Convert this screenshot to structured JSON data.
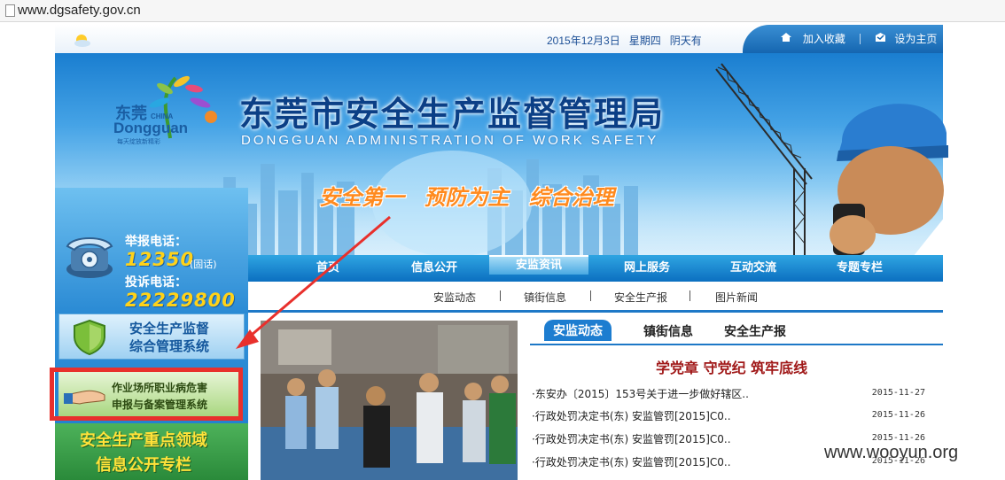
{
  "browser": {
    "url": "www.dgsafety.gov.cn"
  },
  "topbar": {
    "date": "2015年12月3日",
    "weekday": "星期四",
    "weather": "阴天有",
    "favorite": "加入收藏",
    "homepage": "设为主页"
  },
  "banner": {
    "logo_cn": "东莞",
    "logo_china": "CHINA",
    "logo_en": "Dongguan",
    "logo_tag": "每天绽放新精彩",
    "title": "东莞市安全生产监督管理局",
    "subtitle": "DONGGUAN ADMINISTRATION OF WORK SAFETY",
    "slogan": "安全第一 预防为主 综合治理"
  },
  "nav": {
    "items": [
      "首页",
      "信息公开",
      "安监资讯",
      "网上服务",
      "互动交流",
      "专题专栏"
    ],
    "active": "安监资讯"
  },
  "subnav": {
    "items": [
      "安监动态",
      "镇街信息",
      "安全生产报",
      "图片新闻"
    ]
  },
  "sidebar": {
    "report_label": "举报电话：",
    "report_number": "12350",
    "report_note": "(固话)",
    "complaint_label": "投诉电话：",
    "complaint_number": "22229800",
    "system1_line1": "安全生产监督",
    "system1_line2": "综合管理系统",
    "system2_line1": "作业场所职业病危害",
    "system2_line2": "申报与备案管理系统",
    "system3_line1": "安全生产重点领域",
    "system3_line2": "信息公开专栏"
  },
  "news": {
    "tabs": [
      "安监动态",
      "镇街信息",
      "安全生产报"
    ],
    "active_tab": "安监动态",
    "headline": "学党章 守党纪 筑牢底线",
    "rows": [
      {
        "title": "·东安办〔2015〕153号关于进一步做好辖区..",
        "date": "2015-11-27"
      },
      {
        "title": "·行政处罚决定书(东) 安监管罚[2015]C0..",
        "date": "2015-11-26"
      },
      {
        "title": "·行政处罚决定书(东) 安监管罚[2015]C0..",
        "date": "2015-11-26"
      },
      {
        "title": "·行政处罚决定书(东) 安监管罚[2015]C0..",
        "date": "2015-11-26"
      }
    ]
  },
  "watermark": "www.wooyun.org",
  "colors": {
    "nav_blue": "#0b6fc0",
    "title_blue": "#0b3f86",
    "slogan_orange": "#ff8a1e",
    "phone_yellow": "#ffd218",
    "highlight_red": "#e8302c",
    "headline_red": "#a01818"
  }
}
